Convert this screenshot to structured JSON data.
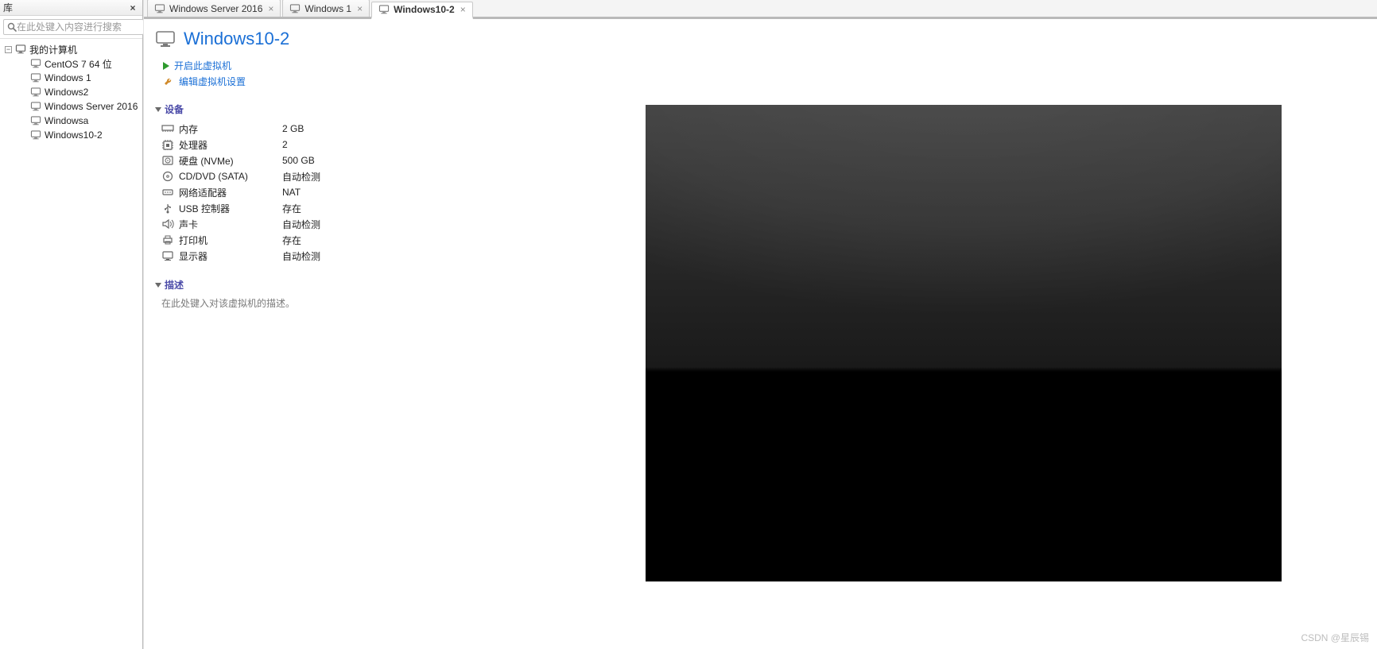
{
  "sidebar": {
    "title": "库",
    "search_placeholder": "在此处键入内容进行搜索",
    "root_label": "我的计算机",
    "items": [
      {
        "label": "CentOS 7 64 位"
      },
      {
        "label": "Windows 1"
      },
      {
        "label": "Windows2"
      },
      {
        "label": "Windows Server 2016"
      },
      {
        "label": "Windowsa"
      },
      {
        "label": "Windows10-2"
      }
    ]
  },
  "tabs": [
    {
      "label": "Windows Server 2016",
      "active": false
    },
    {
      "label": "Windows 1",
      "active": false
    },
    {
      "label": "Windows10-2",
      "active": true
    }
  ],
  "vm": {
    "title": "Windows10-2",
    "actions": {
      "power_on": "开启此虚拟机",
      "edit_settings": "编辑虚拟机设置"
    },
    "sections": {
      "devices_title": "设备",
      "description_title": "描述",
      "description_placeholder": "在此处键入对该虚拟机的描述。"
    },
    "devices": [
      {
        "icon": "memory",
        "label": "内存",
        "value": "2 GB"
      },
      {
        "icon": "cpu",
        "label": "处理器",
        "value": "2"
      },
      {
        "icon": "disk",
        "label": "硬盘 (NVMe)",
        "value": "500 GB"
      },
      {
        "icon": "cd",
        "label": "CD/DVD (SATA)",
        "value": "自动检测"
      },
      {
        "icon": "net",
        "label": "网络适配器",
        "value": "NAT"
      },
      {
        "icon": "usb",
        "label": "USB 控制器",
        "value": "存在"
      },
      {
        "icon": "sound",
        "label": "声卡",
        "value": "自动检测"
      },
      {
        "icon": "printer",
        "label": "打印机",
        "value": "存在"
      },
      {
        "icon": "display",
        "label": "显示器",
        "value": "自动检测"
      }
    ]
  },
  "watermark": "CSDN @星辰锡"
}
